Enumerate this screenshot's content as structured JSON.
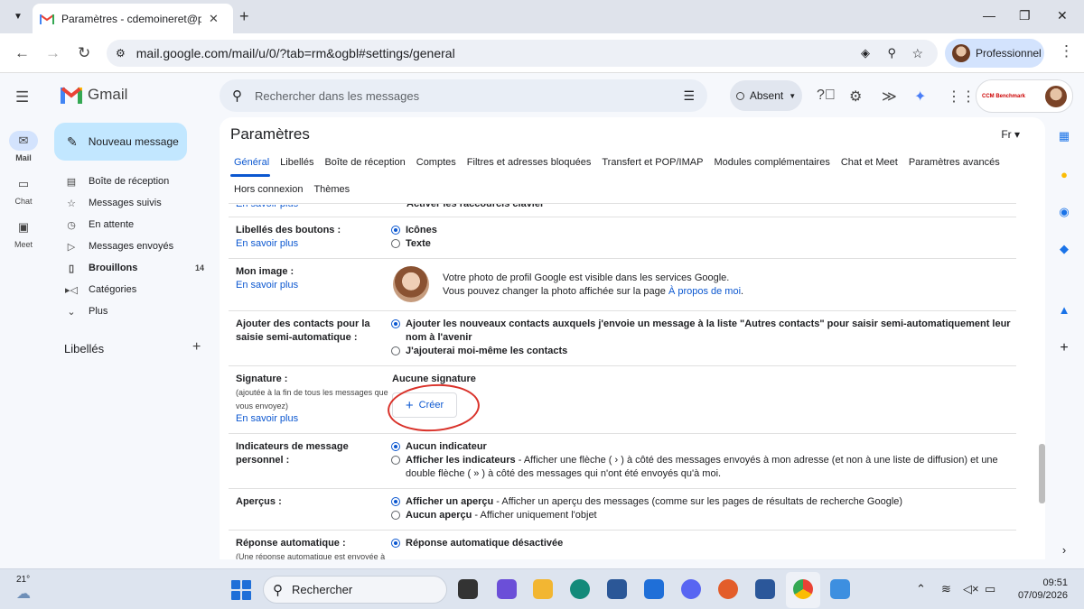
{
  "browser": {
    "tab_title": "Paramètres - cdemoineret@phc",
    "url": "mail.google.com/mail/u/0/?tab=rm&ogbl#settings/general",
    "profile_label": "Professionnel"
  },
  "gmail": {
    "logo_text": "Gmail",
    "search_placeholder": "Rechercher dans les messages",
    "status": "Absent",
    "account_brand": "CCM Benchmark"
  },
  "rail": [
    {
      "label": "Mail",
      "icon": "mail-icon"
    },
    {
      "label": "Chat",
      "icon": "chat-icon"
    },
    {
      "label": "Meet",
      "icon": "video-icon"
    }
  ],
  "nav": {
    "compose": "Nouveau message",
    "items": [
      {
        "label": "Boîte de réception",
        "icon": "inbox-icon"
      },
      {
        "label": "Messages suivis",
        "icon": "star-icon"
      },
      {
        "label": "En attente",
        "icon": "clock-icon"
      },
      {
        "label": "Messages envoyés",
        "icon": "send-icon"
      },
      {
        "label": "Brouillons",
        "icon": "draft-icon",
        "count": "14"
      },
      {
        "label": "Catégories",
        "icon": "label-icon"
      },
      {
        "label": "Plus",
        "icon": "chevron-down-icon"
      }
    ],
    "labels_header": "Libellés"
  },
  "settings": {
    "title": "Paramètres",
    "lang": "Fr",
    "tabs": [
      "Général",
      "Libellés",
      "Boîte de réception",
      "Comptes",
      "Filtres et adresses bloquées",
      "Transfert et POP/IMAP",
      "Modules complémentaires",
      "Chat et Meet",
      "Paramètres avancés"
    ],
    "tabs_row2": [
      "Hors connexion",
      "Thèmes"
    ],
    "learn_more": "En savoir plus",
    "shortcuts_partial": "Activer les raccourcis clavier",
    "button_labels": {
      "label": "Libellés des boutons :",
      "opt1": "Icônes",
      "opt2": "Texte"
    },
    "my_image": {
      "label": "Mon image :",
      "line1": "Votre photo de profil Google est visible dans les services Google.",
      "line2_prefix": "Vous pouvez changer la photo affichée sur la page ",
      "line2_link": "À propos de moi",
      "line2_suffix": "."
    },
    "contacts": {
      "label": "Ajouter des contacts pour la saisie semi-automatique :",
      "opt1": "Ajouter les nouveaux contacts auxquels j'envoie un message à la liste \"Autres contacts\" pour saisir semi-automatiquement leur nom à l'avenir",
      "opt2": "J'ajouterai moi-même les contacts"
    },
    "signature": {
      "label": "Signature :",
      "sub": "(ajoutée à la fin de tous les messages que vous envoyez)",
      "none": "Aucune signature",
      "create": "Créer"
    },
    "indicators": {
      "label": "Indicateurs de message personnel :",
      "opt1": "Aucun indicateur",
      "opt2_bold": "Afficher les indicateurs",
      "opt2_rest": " - Afficher une flèche ( › ) à côté des messages envoyés à mon adresse (et non à une liste de diffusion) et une double flèche ( » ) à côté des messages qui n'ont été envoyés qu'à moi."
    },
    "previews": {
      "label": "Aperçus :",
      "opt1_bold": "Afficher un aperçu",
      "opt1_rest": " - Afficher un aperçu des messages (comme sur les pages de résultats de recherche Google)",
      "opt2_bold": "Aucun aperçu",
      "opt2_rest": " - Afficher uniquement l'objet"
    },
    "auto_reply": {
      "label": "Réponse automatique :",
      "sub": "(Une réponse automatique est envoyée à",
      "opt1": "Réponse automatique désactivée"
    }
  },
  "taskbar": {
    "temp": "21°",
    "search": "Rechercher",
    "time": "09:51",
    "date": "07/09/2026"
  },
  "colors": {
    "accent": "#0b57d0",
    "compose_bg": "#c2e7ff",
    "annotation": "#d9322a"
  }
}
